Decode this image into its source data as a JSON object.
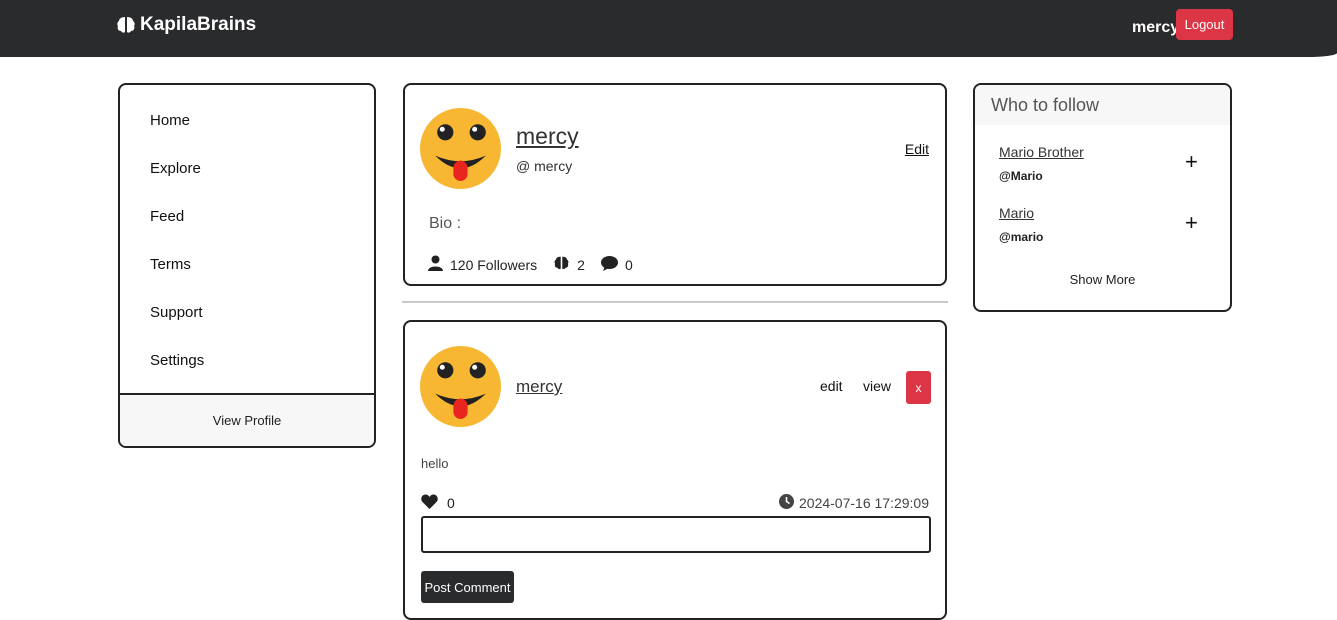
{
  "brand": {
    "name": "KapilaBrains",
    "icon": "brain-icon"
  },
  "nav": {
    "username": "mercy",
    "logout_label": "Logout"
  },
  "sidebar": {
    "items": [
      {
        "label": "Home"
      },
      {
        "label": "Explore"
      },
      {
        "label": "Feed"
      },
      {
        "label": "Terms"
      },
      {
        "label": "Support"
      },
      {
        "label": "Settings"
      }
    ],
    "footer_label": "View Profile"
  },
  "profile": {
    "name": "mercy",
    "handle": "@ mercy",
    "edit_label": "Edit",
    "bio_label": "Bio :",
    "followers": "120 Followers",
    "brains": "2",
    "comments": "0",
    "avatar": "tongue-out-emoji"
  },
  "post": {
    "author": "mercy",
    "edit_label": "edit",
    "view_label": "view",
    "delete_label": "x",
    "text": "hello",
    "likes": "0",
    "timestamp": "2024-07-16 17:29:09",
    "comment_value": "",
    "post_comment_label": "Post Comment"
  },
  "who_to_follow": {
    "title": "Who to follow",
    "users": [
      {
        "name": "Mario Brother",
        "handle": "@Mario"
      },
      {
        "name": "Mario",
        "handle": "@mario"
      }
    ],
    "show_more_label": "Show More"
  },
  "colors": {
    "navbar": "#2a2b2d",
    "danger": "#dc3545",
    "avatar_yellow": "#f7b733"
  }
}
